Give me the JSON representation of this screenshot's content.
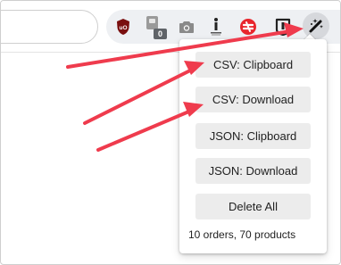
{
  "toolbar": {
    "extensions": [
      {
        "name": "ublock-origin",
        "icon": "ublock-origin-icon",
        "label": "uO"
      },
      {
        "name": "extension-badge",
        "icon": "puzzle-badge-icon",
        "badge": "0"
      },
      {
        "name": "screenshot",
        "icon": "camera-icon"
      },
      {
        "name": "info",
        "icon": "info-icon"
      },
      {
        "name": "red-circle",
        "icon": "red-circle-icon"
      },
      {
        "name": "bookmark",
        "icon": "bookmark-icon"
      },
      {
        "name": "scraper",
        "icon": "magic-wand-icon",
        "active": true
      }
    ],
    "colors": {
      "ublock": "#7a0f0f",
      "red_ext": "#e8262d",
      "active_bg": "#d6d8dc",
      "strip_bg": "#eef0f3"
    }
  },
  "menu": {
    "buttons": [
      {
        "name": "csv-clipboard-button",
        "label": "CSV: Clipboard"
      },
      {
        "name": "csv-download-button",
        "label": "CSV: Download"
      },
      {
        "name": "json-clipboard-button",
        "label": "JSON: Clipboard"
      },
      {
        "name": "json-download-button",
        "label": "JSON: Download"
      },
      {
        "name": "delete-all-button",
        "label": "Delete All"
      }
    ],
    "summary": "10 orders, 70 products"
  },
  "annotations": {
    "arrow_color": "#ef3b4d"
  }
}
